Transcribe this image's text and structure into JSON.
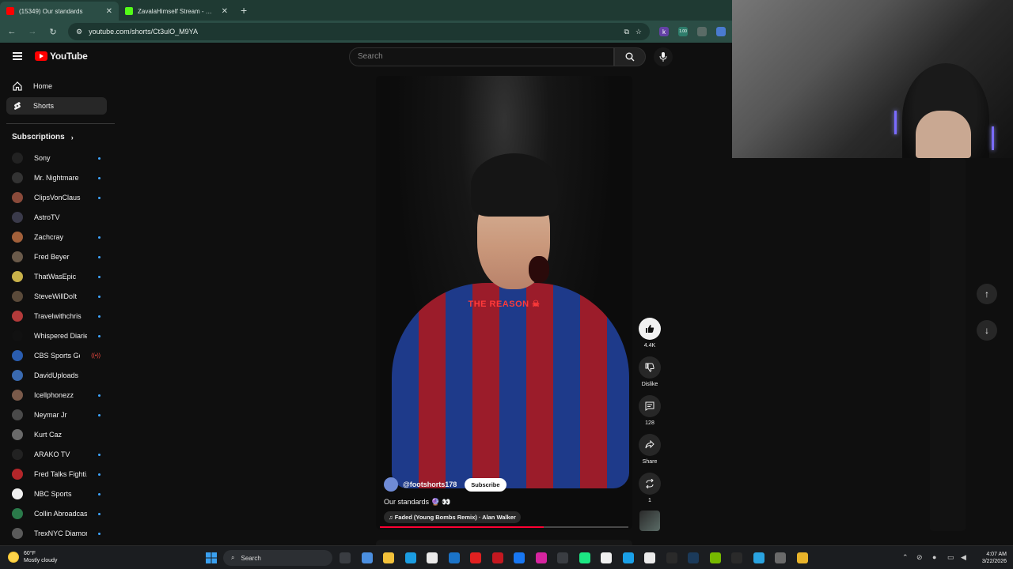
{
  "browser": {
    "tabs": [
      {
        "title": "(15349) Our standards",
        "active": true,
        "fav_color": "#ff0000"
      },
      {
        "title": "ZavalaHimself Stream - Watch",
        "active": false,
        "fav_color": "#53fc18"
      }
    ],
    "url": "youtube.com/shorts/Ct3ulO_M9YA",
    "extensions": [
      {
        "glyph": "k",
        "color": "#6441a5"
      },
      {
        "glyph": "1.00",
        "color": "#2e7d6b"
      },
      {
        "glyph": "",
        "color": "#5a6b66"
      },
      {
        "glyph": "",
        "color": "#4a7bd0"
      }
    ]
  },
  "masthead": {
    "logo_text": "YouTube",
    "search_placeholder": "Search"
  },
  "sidebar": {
    "items": [
      {
        "label": "Home",
        "icon": "home-icon"
      },
      {
        "label": "Shorts",
        "icon": "shorts-icon",
        "active": true
      }
    ],
    "subscriptions_title": "Subscriptions",
    "subscriptions": [
      {
        "name": "Sony",
        "color": "#222222",
        "dot": true
      },
      {
        "name": "Mr. Nightmare",
        "color": "#333333",
        "dot": true
      },
      {
        "name": "ClipsVonClaus",
        "color": "#8a4a3a",
        "dot": true
      },
      {
        "name": "AstroTV",
        "color": "#3a3a4a",
        "dot": false
      },
      {
        "name": "Zachcray",
        "color": "#a2603a",
        "dot": true
      },
      {
        "name": "Fred Beyer",
        "color": "#6a5a4a",
        "dot": true
      },
      {
        "name": "ThatWasEpic",
        "color": "#c9b24a",
        "dot": true
      },
      {
        "name": "SteveWillDoIt",
        "color": "#5a4a3a",
        "dot": true
      },
      {
        "name": "Travelwithchris",
        "color": "#b33a3a",
        "dot": true
      },
      {
        "name": "Whispered Diaries",
        "color": "#111111",
        "dot": true
      },
      {
        "name": "CBS Sports Gola...",
        "color": "#2a5db0",
        "dot": false,
        "live": true
      },
      {
        "name": "DavidUploads",
        "color": "#3a6ab0",
        "dot": false
      },
      {
        "name": "Icellphonezz",
        "color": "#7a5a4a",
        "dot": true
      },
      {
        "name": "Neymar Jr",
        "color": "#4a4a4a",
        "dot": true
      },
      {
        "name": "Kurt Caz",
        "color": "#6a6a6a",
        "dot": false
      },
      {
        "name": "ARAKO TV",
        "color": "#222222",
        "dot": true
      },
      {
        "name": "Fred Talks Fighti...",
        "color": "#b3262a",
        "dot": true
      },
      {
        "name": "NBC Sports",
        "color": "#f1f1f1",
        "dot": true
      },
      {
        "name": "Collin Abroadcast",
        "color": "#2a7a4a",
        "dot": true
      },
      {
        "name": "TrexNYC Diamon...",
        "color": "#5a5a5a",
        "dot": true
      }
    ]
  },
  "short": {
    "overlay_text": "THE REASON ☠",
    "channel": "@footshorts178",
    "subscribe_label": "Subscribe",
    "caption": "Our standards 🔮 👀",
    "music": "♫ Faded (Young Bombs Remix) · Alan Walker",
    "progress": 0.66
  },
  "actions": {
    "like_count": "4.4K",
    "dislike_label": "Dislike",
    "comment_count": "128",
    "share_label": "Share",
    "remix_count": "1"
  },
  "taskbar": {
    "temperature": "60°F",
    "weather": "Mostly cloudy",
    "search_label": "Search",
    "time": "4:07 AM",
    "date": "3/22/2026",
    "apps": [
      {
        "name": "task-view",
        "color": "#3a3d42"
      },
      {
        "name": "copilot",
        "color": "#4b8fe0"
      },
      {
        "name": "file-explorer",
        "color": "#f2c13a"
      },
      {
        "name": "edge",
        "color": "#1b9de2"
      },
      {
        "name": "store",
        "color": "#eaeaea"
      },
      {
        "name": "outlook",
        "color": "#1a73c8"
      },
      {
        "name": "youtube",
        "color": "#e02020"
      },
      {
        "name": "netflix",
        "color": "#c41820"
      },
      {
        "name": "facebook",
        "color": "#1877f2"
      },
      {
        "name": "instagram",
        "color": "#d6249f"
      },
      {
        "name": "calculator",
        "color": "#3a3d42"
      },
      {
        "name": "hulu",
        "color": "#1ce783"
      },
      {
        "name": "amazon",
        "color": "#f0f0f0"
      },
      {
        "name": "prime-video",
        "color": "#1aa0e8"
      },
      {
        "name": "roblox",
        "color": "#eaeaea"
      },
      {
        "name": "g-hub",
        "color": "#2a2a2a"
      },
      {
        "name": "steam",
        "color": "#1b3a5a"
      },
      {
        "name": "nvidia",
        "color": "#76b900"
      },
      {
        "name": "epic-games",
        "color": "#2a2a2a"
      },
      {
        "name": "telegram",
        "color": "#2aa3e0"
      },
      {
        "name": "settings",
        "color": "#6a6a6a"
      },
      {
        "name": "chrome",
        "color": "#e8b32a"
      }
    ]
  }
}
